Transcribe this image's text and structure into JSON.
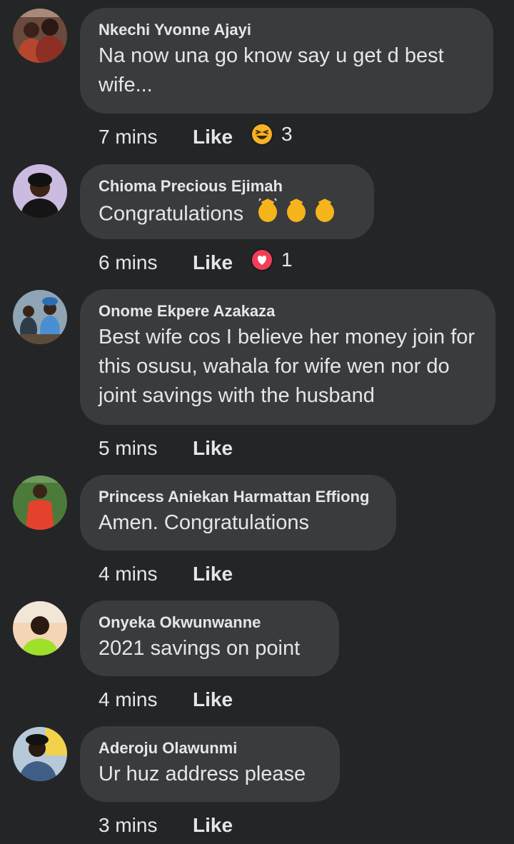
{
  "comments": [
    {
      "author": "Nkechi Yvonne Ajayi",
      "text": "Na now una go know say u get d best wife...",
      "time": "7 mins",
      "like": "Like",
      "reaction": "laugh-reaction-icon",
      "reaction_count": "3"
    },
    {
      "author": "Chioma Precious Ejimah",
      "text": "Congratulations",
      "text_emoji": "clapping-hands-icon",
      "time": "6 mins",
      "like": "Like",
      "reaction": "love-reaction-icon",
      "reaction_count": "1"
    },
    {
      "author": "Onome Ekpere Azakaza",
      "text": "Best wife cos I believe her money join for this osusu, wahala for wife wen nor do joint savings with the husband",
      "time": "5 mins",
      "like": "Like"
    },
    {
      "author": "Princess Aniekan Harmattan Effiong",
      "text": "Amen. Congratulations",
      "time": "4 mins",
      "like": "Like"
    },
    {
      "author": "Onyeka Okwunwanne",
      "text": "2021 savings on point",
      "time": "4 mins",
      "like": "Like"
    },
    {
      "author": "Aderoju Olawunmi",
      "text": "Ur huz address please",
      "time": "3 mins",
      "like": "Like"
    }
  ],
  "colors": {
    "background": "#242526",
    "bubble": "#3a3b3c",
    "text": "#e4e6eb",
    "laugh_reaction": "#f7b125",
    "love_reaction": "#f33e58"
  }
}
